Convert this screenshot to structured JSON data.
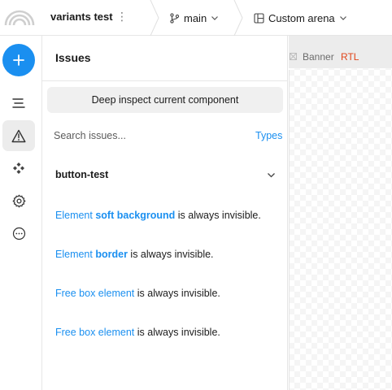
{
  "header": {
    "project_name": "variants test",
    "branch": "main",
    "arena": "Custom arena"
  },
  "rail": {
    "items": [
      {
        "icon": "plus-icon",
        "active": false
      },
      {
        "icon": "outline-icon",
        "active": false
      },
      {
        "icon": "warning-icon",
        "active": true
      },
      {
        "icon": "components-icon",
        "active": false
      },
      {
        "icon": "gear-icon",
        "active": false
      },
      {
        "icon": "more-icon",
        "active": false
      }
    ]
  },
  "issues": {
    "title": "Issues",
    "inspect_button": "Deep inspect current component",
    "search_placeholder": "Search issues...",
    "types_label": "Types",
    "group": "button-test",
    "items": [
      {
        "link_prefix": "Element ",
        "link_bold": "soft background",
        "rest": " is always invisible."
      },
      {
        "link_prefix": "Element ",
        "link_bold": "border",
        "rest": " is always invisible."
      },
      {
        "link_prefix": "Free box element",
        "link_bold": "",
        "rest": " is always invisible."
      },
      {
        "link_prefix": "Free box element",
        "link_bold": "",
        "rest": " is always invisible."
      }
    ]
  },
  "canvas": {
    "frame_name": "Banner",
    "frame_tag": "RTL"
  },
  "colors": {
    "accent": "#1a8ff0",
    "tag": "#e0461b"
  }
}
